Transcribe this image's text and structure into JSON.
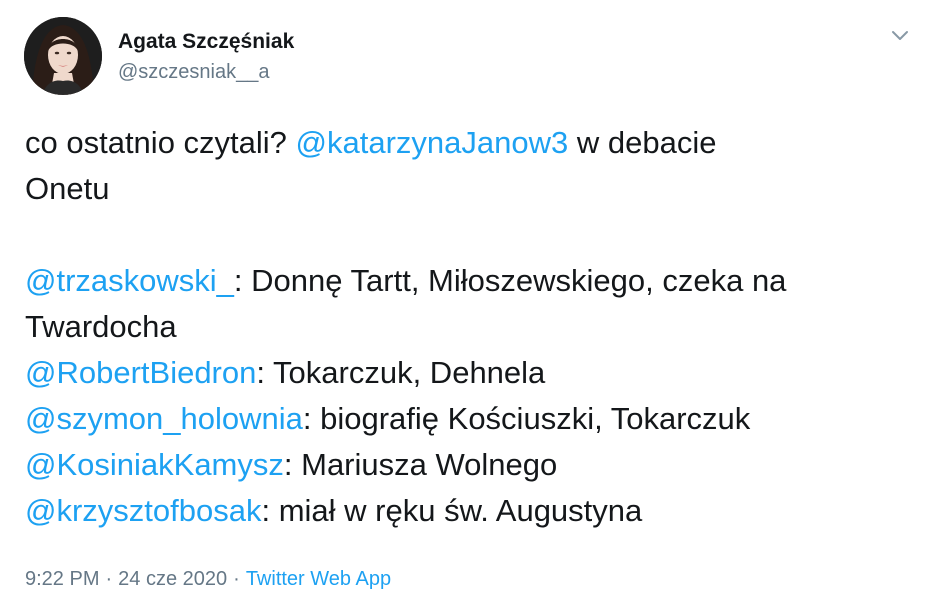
{
  "author": {
    "display_name": "Agata Szczęśniak",
    "handle": "@szczesniak__a",
    "avatar_icon": "avatar-photo"
  },
  "menu": {
    "caret_icon": "chevron-down-icon"
  },
  "tweet": {
    "intro": {
      "text": "co ostatnio czytali? ",
      "mention": "@katarzynaJanow3",
      "after": " w debacie",
      "line2": "Onetu"
    },
    "answers": [
      {
        "mention": "@trzaskowski_",
        "text": ": Donnę Tartt, Miłoszewskiego, czeka na",
        "continuation": "Twardocha"
      },
      {
        "mention": "@RobertBiedron",
        "text": ": Tokarczuk, Dehnela"
      },
      {
        "mention": "@szymon_holownia",
        "text": ": biografię Kościuszki, Tokarczuk"
      },
      {
        "mention": "@KosiniakKamysz",
        "text": ": Mariusza Wolnego"
      },
      {
        "mention": "@krzysztofbosak",
        "text": ": miał w ręku św. Augustyna"
      }
    ]
  },
  "meta": {
    "time": "9:22 PM",
    "separator": "·",
    "date": "24 cze 2020",
    "source": "Twitter Web App"
  },
  "colors": {
    "link": "#1da1f2",
    "text": "#14171a",
    "secondary": "#657786"
  }
}
